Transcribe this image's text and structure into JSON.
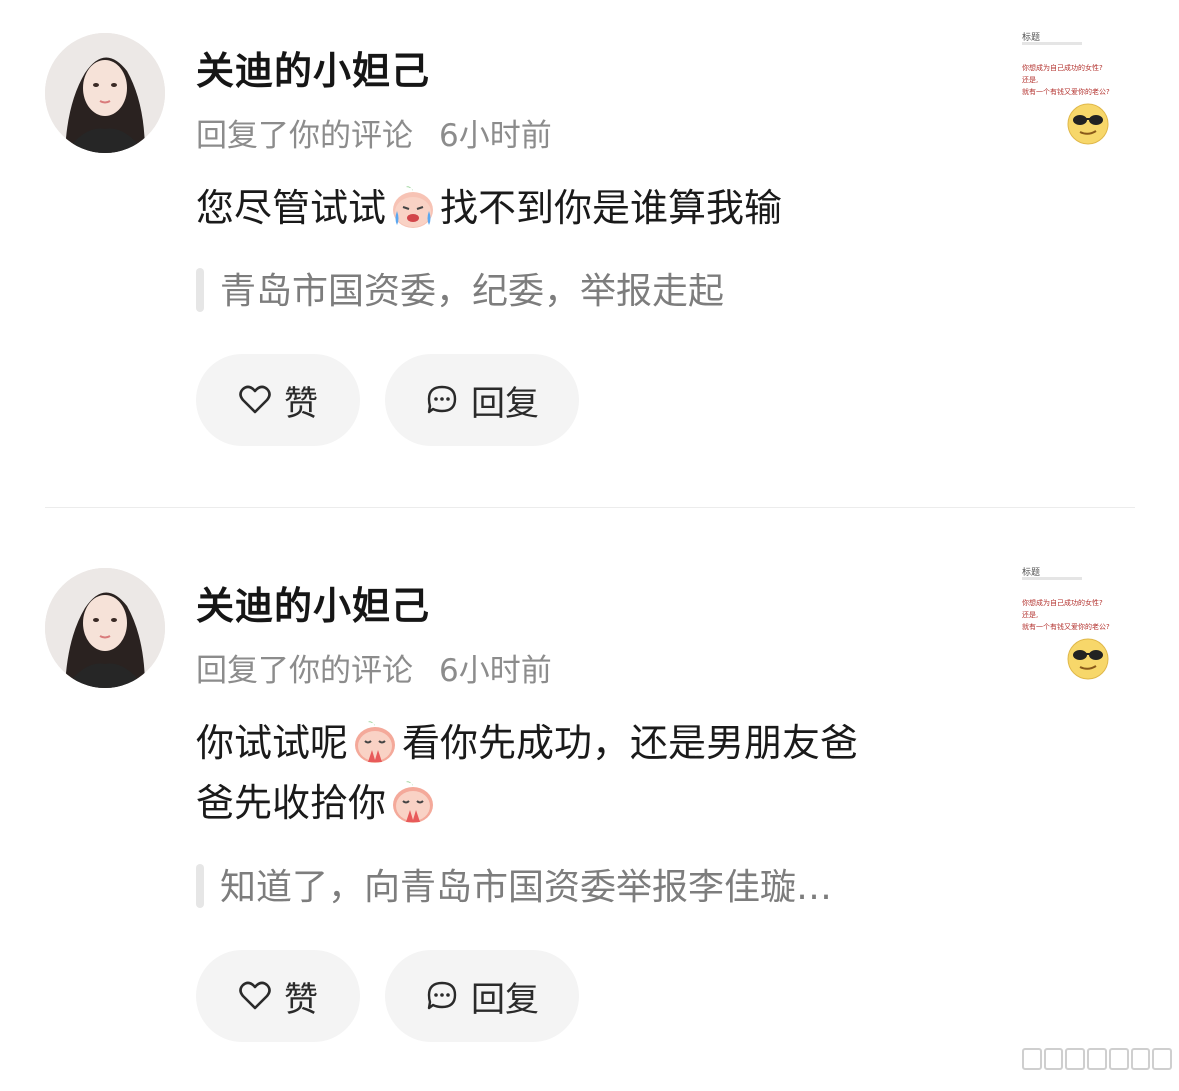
{
  "notifications": [
    {
      "username": "关迪的小妲己",
      "action": "回复了你的评论",
      "time": "6小时前",
      "content_parts": [
        "您尽管试试",
        "找不到你是谁算我输"
      ],
      "emojis": [
        "crying-peach-emoji"
      ],
      "quoted_comment": "青岛市国资委，纪委，举报走起",
      "like_label": "赞",
      "reply_label": "回复",
      "thumbnail": {
        "title": "标题",
        "lines": [
          "你想成为自己成功的女性?",
          "还是,",
          "就有一个有钱又爱你的老公?"
        ]
      }
    },
    {
      "username": "关迪的小妲己",
      "action": "回复了你的评论",
      "time": "6小时前",
      "content_parts": [
        "你试试呢",
        "看你先成功，还是男朋友爸",
        "爸先收拾你"
      ],
      "emojis": [
        "praying-peach-emoji",
        "praying-peach-emoji"
      ],
      "quoted_comment": "知道了，向青岛市国资委举报李佳璇…",
      "like_label": "赞",
      "reply_label": "回复",
      "thumbnail": {
        "title": "标题",
        "lines": [
          "你想成为自己成功的女性?",
          "还是,",
          "就有一个有钱又爱你的老公?"
        ]
      }
    }
  ]
}
